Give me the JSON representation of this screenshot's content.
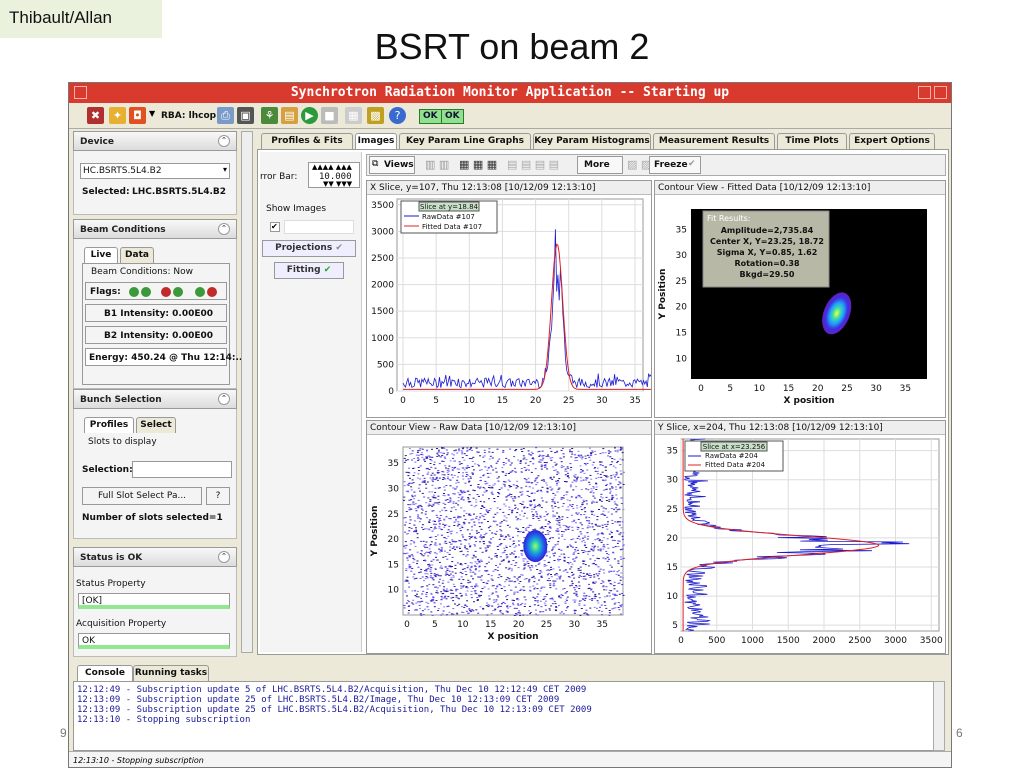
{
  "slide": {
    "author": "Thibault/Allan",
    "title": "BSRT on beam 2",
    "page_left": "9",
    "page_right": "6"
  },
  "window": {
    "title": "Synchrotron Radiation Monitor Application -- Starting up"
  },
  "toolbar": {
    "rba_label": "RBA: lhcop",
    "ok1": "OK",
    "ok2": "OK"
  },
  "device": {
    "header": "Device",
    "selected_device": "HC.BSRTS.5L4.B2",
    "selected_label": "Selected:",
    "selected_value": "LHC.BSRTS.5L4.B2"
  },
  "beam": {
    "header": "Beam Conditions",
    "tabs": [
      "Live",
      "Data"
    ],
    "group": "Beam Conditions: Now",
    "flags_label": "Flags:",
    "b1": "B1 Intensity: 0.00E00",
    "b2": "B2 Intensity: 0.00E00",
    "energy": "Energy: 450.24 @ Thu 12:14:.."
  },
  "bunch": {
    "header": "Bunch Selection",
    "tabs": [
      "Profiles",
      "Select"
    ],
    "slots_label": "Slots to display",
    "selection_label": "Selection:",
    "full_slot_button": "Full Slot Select Pa...",
    "help_button": "?",
    "num_slots": "Number of slots selected=1"
  },
  "status": {
    "header": "Status is OK",
    "status_property": "Status Property",
    "status_value": "[OK]",
    "acq_property": "Acquisition Property",
    "acq_value": "OK"
  },
  "tabs": [
    "Profiles & Fits",
    "Images",
    "Key Param Line Graphs",
    "Key Param Histograms",
    "Measurement Results",
    "Time Plots",
    "Expert Options"
  ],
  "active_tab": "Images",
  "sub": {
    "error_bar_label": "rror Bar:",
    "error_bar_value": "10.000",
    "show_images": "Show Images",
    "projections": "Projections",
    "fitting": "Fitting"
  },
  "viewbar": {
    "views": "Views",
    "more": "More",
    "freeze": "Freeze"
  },
  "plots": {
    "xslice": {
      "title": "X Slice, y=107, Thu 12:13:08  [10/12/09 12:13:10]",
      "legend_title": "Slice at y=18.84",
      "legend_raw": "RawData #107",
      "legend_fit": "Fitted Data #107",
      "xticks": [
        "0",
        "5",
        "10",
        "15",
        "20",
        "25",
        "30",
        "35"
      ],
      "yticks": [
        "0",
        "500",
        "1000",
        "1500",
        "2000",
        "2500",
        "3000",
        "3500"
      ]
    },
    "contour_fit": {
      "title": "Contour View - Fitted Data  [10/12/09 12:13:10]",
      "fit_title": "Fit Results:",
      "fit_lines": [
        "Amplitude=2,735.84",
        "Center X, Y=23.25, 18.72",
        "Sigma X, Y=0.85, 1.62",
        "Rotation=0.38",
        "Bkgd=29.50"
      ],
      "xlabel": "X position",
      "ylabel": "Y Position",
      "xticks": [
        "0",
        "5",
        "10",
        "15",
        "20",
        "25",
        "30",
        "35"
      ],
      "yticks": [
        "10",
        "15",
        "20",
        "25",
        "30",
        "35"
      ]
    },
    "contour_raw": {
      "title": "Contour View - Raw Data  [10/12/09 12:13:10]",
      "xlabel": "X position",
      "ylabel": "Y Position",
      "xticks": [
        "0",
        "5",
        "10",
        "15",
        "20",
        "25",
        "30",
        "35"
      ],
      "yticks": [
        "10",
        "15",
        "20",
        "25",
        "30",
        "35"
      ]
    },
    "yslice": {
      "title": "Y Slice, x=204, Thu 12:13:08  [10/12/09 12:13:10]",
      "legend_title": "Slice at x=23.256",
      "legend_raw": "RawData #204",
      "legend_fit": "Fitted Data #204",
      "xticks": [
        "0",
        "500",
        "1000",
        "1500",
        "2000",
        "2500",
        "3000",
        "3500"
      ],
      "yticks": [
        "5",
        "10",
        "15",
        "20",
        "25",
        "30",
        "35"
      ]
    }
  },
  "console": {
    "tabs": [
      "Console",
      "Running tasks"
    ],
    "lines": [
      "12:12:49 - Subscription update 5 of LHC.BSRTS.5L4.B2/Acquisition, Thu Dec 10 12:12:49 CET 2009",
      "12:13:09 - Subscription update 25 of LHC.BSRTS.5L4.B2/Image, Thu Dec 10 12:13:09 CET 2009",
      "12:13:09 - Subscription update 25 of LHC.BSRTS.5L4.B2/Acquisition, Thu Dec 10 12:13:09 CET 2009",
      "12:13:10 - Stopping subscription"
    ],
    "status": "12:13:10 - Stopping subscription"
  },
  "colors": {
    "titlebar": "#d83a2e",
    "raw": "#1a1ad0",
    "fit": "#e02020",
    "ok_green": "#8fe08f"
  }
}
